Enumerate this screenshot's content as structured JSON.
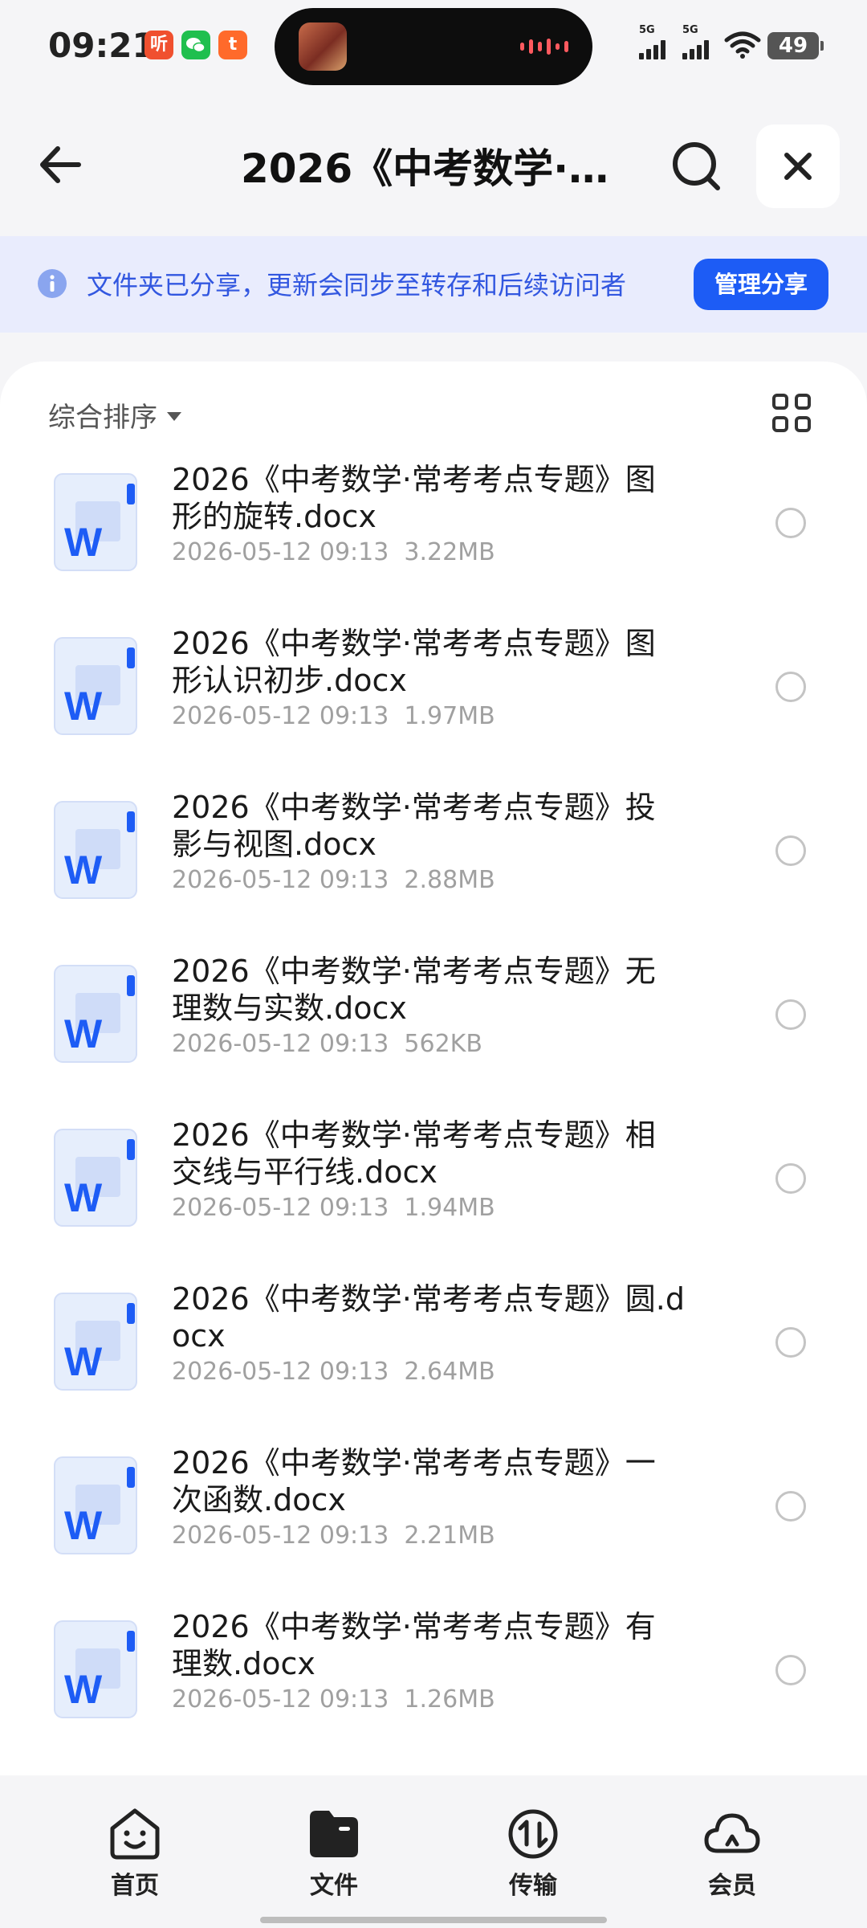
{
  "status_bar": {
    "time": "09:21",
    "app_badges": [
      {
        "icon": "ting-app-icon",
        "text": "听",
        "color": "#f0502f"
      },
      {
        "icon": "wechat-icon",
        "text": "",
        "color": "#1fbf4e"
      },
      {
        "icon": "taobao-icon",
        "text": "t",
        "color": "#ff6a2b"
      }
    ],
    "signal_labels": [
      "5G",
      "5G"
    ],
    "battery": "49"
  },
  "header": {
    "title": "2026《中考数学·…",
    "back_icon": "back-arrow-icon",
    "search_icon": "search-icon",
    "close_icon": "close-icon"
  },
  "banner": {
    "icon": "info-icon",
    "text": "文件夹已分享，更新会同步至转存和后续访问者",
    "button": "管理分享",
    "accent": "#1d5cf5"
  },
  "list": {
    "sort_label": "综合排序",
    "view_toggle_icon": "grid-view-icon",
    "files": [
      {
        "name": "2026《中考数学·常考考点专题》图形的旋转.docx",
        "date": "2026-05-12 09:13",
        "size": "3.22MB"
      },
      {
        "name": "2026《中考数学·常考考点专题》图形认识初步.docx",
        "date": "2026-05-12 09:13",
        "size": "1.97MB"
      },
      {
        "name": "2026《中考数学·常考考点专题》投影与视图.docx",
        "date": "2026-05-12 09:13",
        "size": "2.88MB"
      },
      {
        "name": "2026《中考数学·常考考点专题》无理数与实数.docx",
        "date": "2026-05-12 09:13",
        "size": "562KB"
      },
      {
        "name": "2026《中考数学·常考考点专题》相交线与平行线.docx",
        "date": "2026-05-12 09:13",
        "size": "1.94MB"
      },
      {
        "name": "2026《中考数学·常考考点专题》圆.docx",
        "date": "2026-05-12 09:13",
        "size": "2.64MB"
      },
      {
        "name": "2026《中考数学·常考考点专题》一次函数.docx",
        "date": "2026-05-12 09:13",
        "size": "2.21MB"
      },
      {
        "name": "2026《中考数学·常考考点专题》有理数.docx",
        "date": "2026-05-12 09:13",
        "size": "1.26MB"
      }
    ],
    "file_icon": "word-doc-icon",
    "file_icon_letter": "W"
  },
  "bottom_nav": [
    {
      "label": "首页",
      "icon": "home-smile-icon"
    },
    {
      "label": "文件",
      "icon": "folder-icon",
      "active": true
    },
    {
      "label": "传输",
      "icon": "transfer-icon"
    },
    {
      "label": "会员",
      "icon": "cloud-member-icon"
    }
  ]
}
